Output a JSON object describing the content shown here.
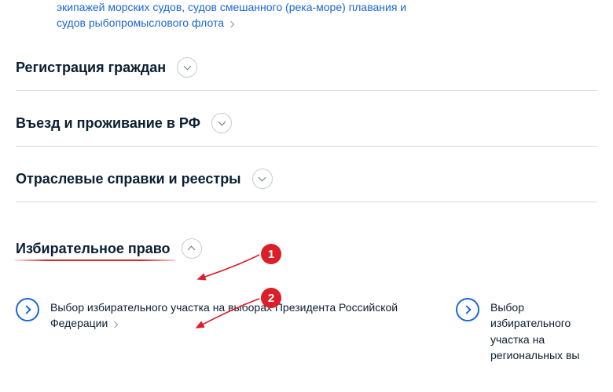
{
  "top_link": {
    "text_line1": "экипажей морских судов, судов смешанного (река-море) плавания и",
    "text_line2": "судов рыбопромыслового флота"
  },
  "sections": {
    "registration": {
      "title": "Регистрация граждан"
    },
    "entry": {
      "title": "Въезд и проживание в РФ"
    },
    "registries": {
      "title": "Отраслевые справки и реестры"
    },
    "electoral": {
      "title": "Избирательное право"
    }
  },
  "electoral_items": {
    "item1": "Выбор избирательного участка на выборах Президента Российской Федерации",
    "item2": "Выбор избирательного участка на региональных вы"
  },
  "annotations": {
    "badge1": "1",
    "badge2": "2"
  }
}
